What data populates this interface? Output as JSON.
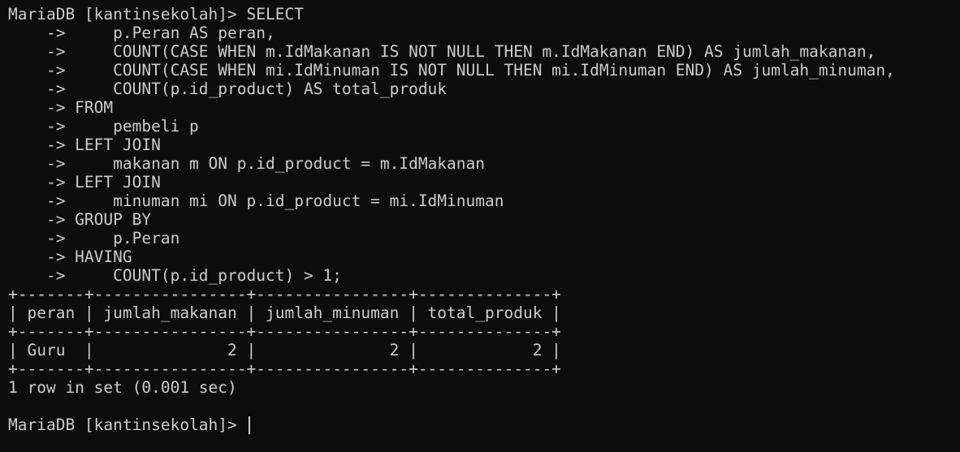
{
  "terminal": {
    "lines": [
      "MariaDB [kantinsekolah]> SELECT",
      "    ->     p.Peran AS peran,",
      "    ->     COUNT(CASE WHEN m.IdMakanan IS NOT NULL THEN m.IdMakanan END) AS jumlah_makanan,",
      "    ->     COUNT(CASE WHEN mi.IdMinuman IS NOT NULL THEN mi.IdMinuman END) AS jumlah_minuman,",
      "    ->     COUNT(p.id_product) AS total_produk",
      "    -> FROM",
      "    ->     pembeli p",
      "    -> LEFT JOIN",
      "    ->     makanan m ON p.id_product = m.IdMakanan",
      "    -> LEFT JOIN",
      "    ->     minuman mi ON p.id_product = mi.IdMinuman",
      "    -> GROUP BY",
      "    ->     p.Peran",
      "    -> HAVING",
      "    ->     COUNT(p.id_product) > 1;",
      "+-------+----------------+----------------+--------------+",
      "| peran | jumlah_makanan | jumlah_minuman | total_produk |",
      "+-------+----------------+----------------+--------------+",
      "| Guru  |              2 |              2 |            2 |",
      "+-------+----------------+----------------+--------------+",
      "1 row in set (0.001 sec)",
      "",
      "MariaDB [kantinsekolah]> "
    ]
  }
}
